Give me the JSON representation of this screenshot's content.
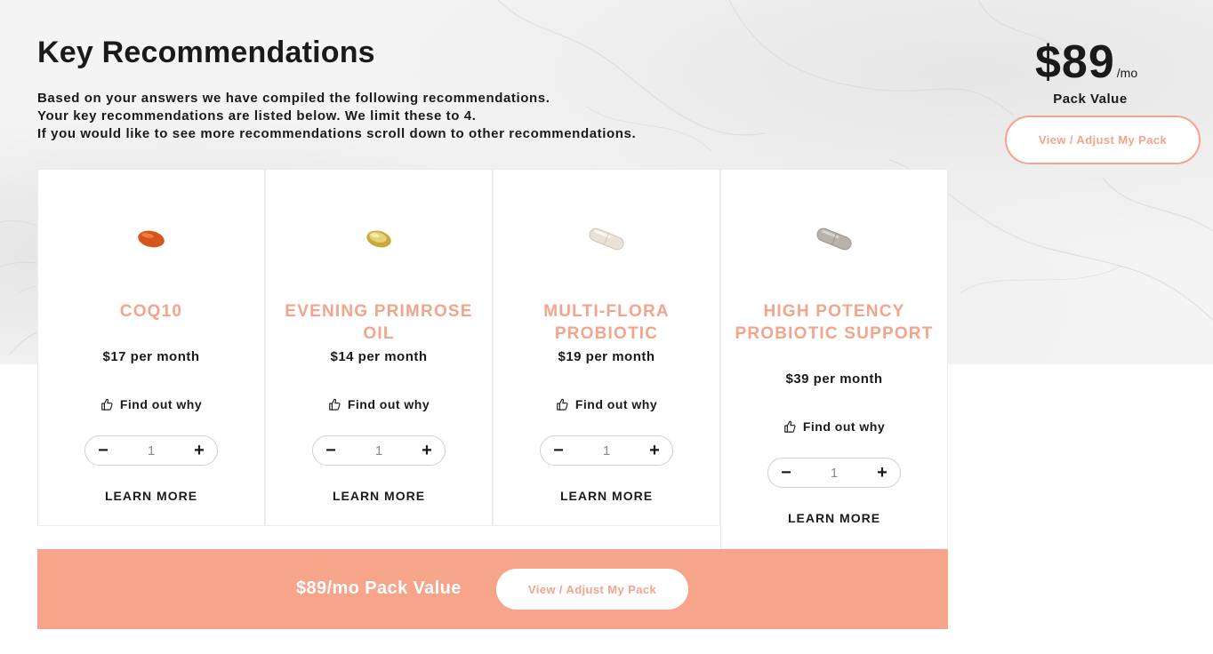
{
  "header": {
    "title": "Key Recommendations",
    "intro_lines": [
      "Based on your answers we have compiled the following recommendations.",
      "Your key recommendations are listed below. We limit these to 4.",
      "If you would like to see more recommendations scroll down to other recommendations."
    ]
  },
  "pack": {
    "price": "$89",
    "per": "/mo",
    "label": "Pack Value",
    "button_label": "View / Adjust My Pack"
  },
  "products": [
    {
      "name": "COQ10",
      "price": "$17 per month",
      "find_out": "Find out why",
      "quantity": "1",
      "learn_more": "LEARN MORE",
      "pill_icon": "orange-softgel-icon"
    },
    {
      "name": "EVENING PRIMROSE OIL",
      "price": "$14 per month",
      "find_out": "Find out why",
      "quantity": "1",
      "learn_more": "LEARN MORE",
      "pill_icon": "yellow-softgel-icon"
    },
    {
      "name": "MULTI-FLORA PROBIOTIC",
      "price": "$19 per month",
      "find_out": "Find out why",
      "quantity": "1",
      "learn_more": "LEARN MORE",
      "pill_icon": "white-capsule-icon"
    },
    {
      "name": "HIGH POTENCY PROBIOTIC SUPPORT",
      "price": "$39 per month",
      "find_out": "Find out why",
      "quantity": "1",
      "learn_more": "LEARN MORE",
      "pill_icon": "grey-capsule-icon"
    }
  ],
  "stepper": {
    "minus": "−",
    "plus": "+"
  },
  "banner": {
    "text": "$89/mo Pack Value",
    "button_label": "View / Adjust My Pack"
  },
  "colors": {
    "accent": "#f3a48c",
    "banner": "#f6a48a"
  }
}
